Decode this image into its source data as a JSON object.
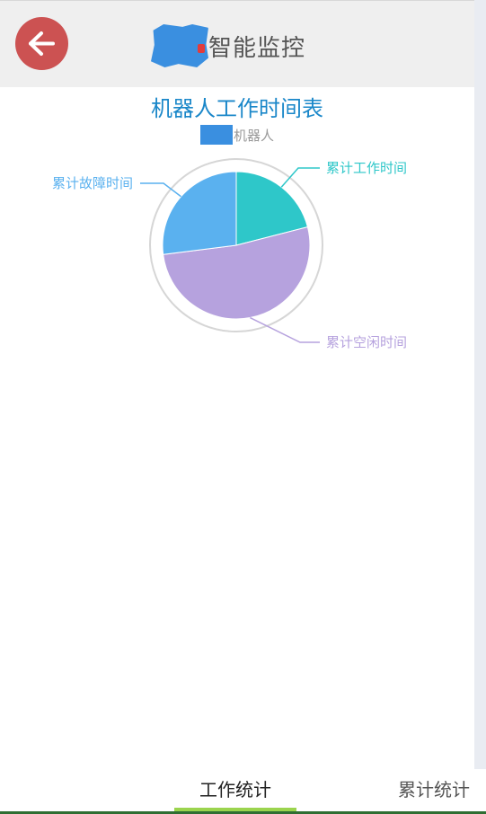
{
  "header": {
    "title": "智能监控",
    "back_icon": "arrow-left-icon",
    "back_color": "#cc5252"
  },
  "chart_data": {
    "type": "pie",
    "title": "机器人工作时间表",
    "subtitle": "机器人",
    "categories": [
      "累计工作时间",
      "累计空闲时间",
      "累计故障时间"
    ],
    "values": [
      21,
      52,
      27
    ],
    "colors": [
      "#2ec7c9",
      "#b6a2de",
      "#5ab1ef"
    ],
    "legend": "none"
  },
  "tabs": [
    {
      "label": "工作统计",
      "active": true
    },
    {
      "label": "累计统计",
      "active": false
    }
  ],
  "colors": {
    "tab_active_underline": "#9bd44e",
    "title": "#1a87c9"
  }
}
